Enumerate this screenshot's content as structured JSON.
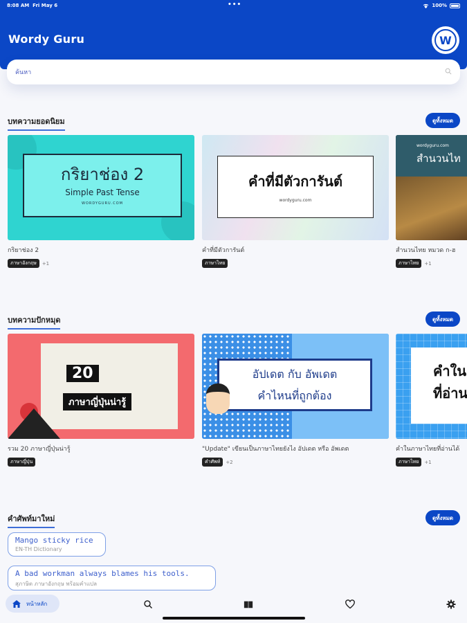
{
  "status": {
    "time": "8:08 AM",
    "date": "Fri May 6",
    "battery": "100%"
  },
  "app": {
    "title": "Wordy Guru",
    "logo_letter": "W"
  },
  "search": {
    "placeholder": "ค้นหา"
  },
  "popular": {
    "title": "บทความยอดนิยม",
    "see_all": "ดูทั้งหมด",
    "cards": [
      {
        "thumb_title": "กริยาช่อง 2",
        "thumb_sub": "Simple Past Tense",
        "thumb_small": "WORDYGURU.COM",
        "title": "กริยาช่อง 2",
        "tag": "ภาษาอังกฤษ",
        "more": "+1"
      },
      {
        "thumb_title": "คำที่มีตัวการันต์",
        "thumb_small": "wordyguru.com",
        "title": "คำที่มีตัวการันต์",
        "tag": "ภาษาไทย"
      },
      {
        "thumb_small": "wordyguru.com",
        "thumb_title": "สำนวนไท",
        "title": "สำนวนไทย หมวด ก-ฮ",
        "tag": "ภาษาไทย",
        "more": "+1"
      }
    ]
  },
  "pinned": {
    "title": "บทความปักหมุด",
    "see_all": "ดูทั้งหมด",
    "cards": [
      {
        "thumb_num": "20",
        "thumb_title": "ภาษาญี่ปุ่นน่ารู้",
        "title": "รวม 20 ภาษาญี่ปุ่นน่ารู้",
        "tag": "ภาษาญี่ปุ่น"
      },
      {
        "thumb_a": "อัปเดต กับ อัพเดต",
        "thumb_b": "คำไหนที่ถูกต้อง",
        "title": "\"Update\" เขียนเป็นภาษาไทยยังไง อัปเดต หรือ อัพเดต",
        "tag": "คำศัพท์",
        "more": "+2"
      },
      {
        "thumb_a": "คำใน",
        "thumb_b": "ที่อ่าน",
        "title": "คำในภาษาไทยที่อ่านได้",
        "tag": "ภาษาไทย",
        "more": "+1"
      }
    ]
  },
  "new_words": {
    "title": "คำศัพท์มาใหม่",
    "see_all": "ดูทั้งหมด",
    "items": [
      {
        "word": "Mango sticky rice",
        "sub": "EN-TH Dictionary"
      },
      {
        "word": "A bad workman always blames his tools.",
        "sub": "สุภาษิต ภาษาอังกฤษ พร้อมคำแปล"
      }
    ]
  },
  "nav": {
    "home": "หน้าหลัก"
  },
  "colors": {
    "primary": "#0b47c6",
    "background": "#f6f7fb"
  }
}
